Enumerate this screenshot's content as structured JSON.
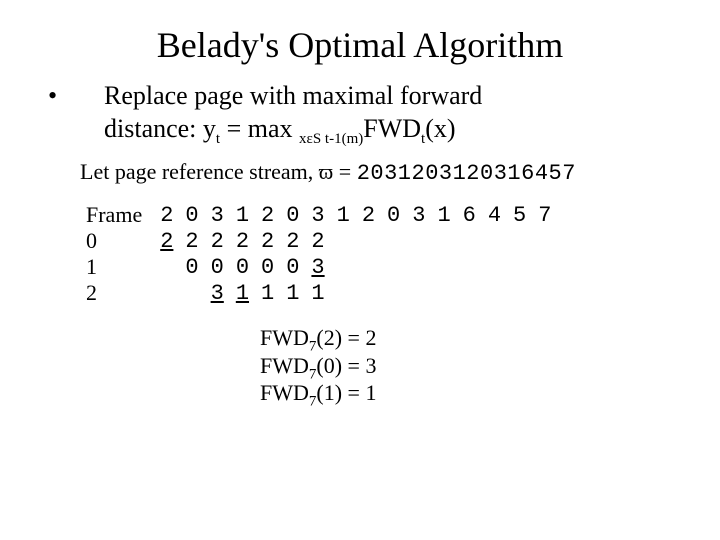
{
  "title": "Belady's Optimal Algorithm",
  "bullet": {
    "line1": "Replace page with maximal forward",
    "line2_a": "distance: y",
    "line2_sub1": "t",
    "line2_b": " = max ",
    "line2_sub2": "xεS t-1(m)",
    "line2_c": "FWD",
    "line2_sub3": "t",
    "line2_d": "(x)"
  },
  "stream_label": "Let page reference stream, ϖ = ",
  "stream_value": "2031203120316457",
  "table": {
    "headers": [
      "Frame",
      "2",
      "0",
      "3",
      "1",
      "2",
      "0",
      "3",
      "1",
      "2",
      "0",
      "3",
      "1",
      "6",
      "4",
      "5",
      "7"
    ],
    "rows": [
      {
        "label": "0",
        "cells": [
          "2",
          "2",
          "2",
          "2",
          "2",
          "2",
          "2",
          "",
          "",
          "",
          "",
          "",
          "",
          "",
          "",
          ""
        ],
        "underline": [
          0
        ]
      },
      {
        "label": "1",
        "cells": [
          "",
          "0",
          "0",
          "0",
          "0",
          "0",
          "3",
          "",
          "",
          "",
          "",
          "",
          "",
          "",
          "",
          ""
        ],
        "underline": [
          6
        ]
      },
      {
        "label": "2",
        "cells": [
          "",
          "",
          "3",
          "1",
          "1",
          "1",
          "1",
          "",
          "",
          "",
          "",
          "",
          "",
          "",
          "",
          ""
        ],
        "underline": [
          2,
          3
        ]
      }
    ]
  },
  "fwd": {
    "l1a": "FWD",
    "l1sub": "7",
    "l1b": "(2) = 2",
    "l2a": "FWD",
    "l2sub": "7",
    "l2b": "(0) = 3",
    "l3a": "FWD",
    "l3sub": "7",
    "l3b": "(1) = 1"
  }
}
